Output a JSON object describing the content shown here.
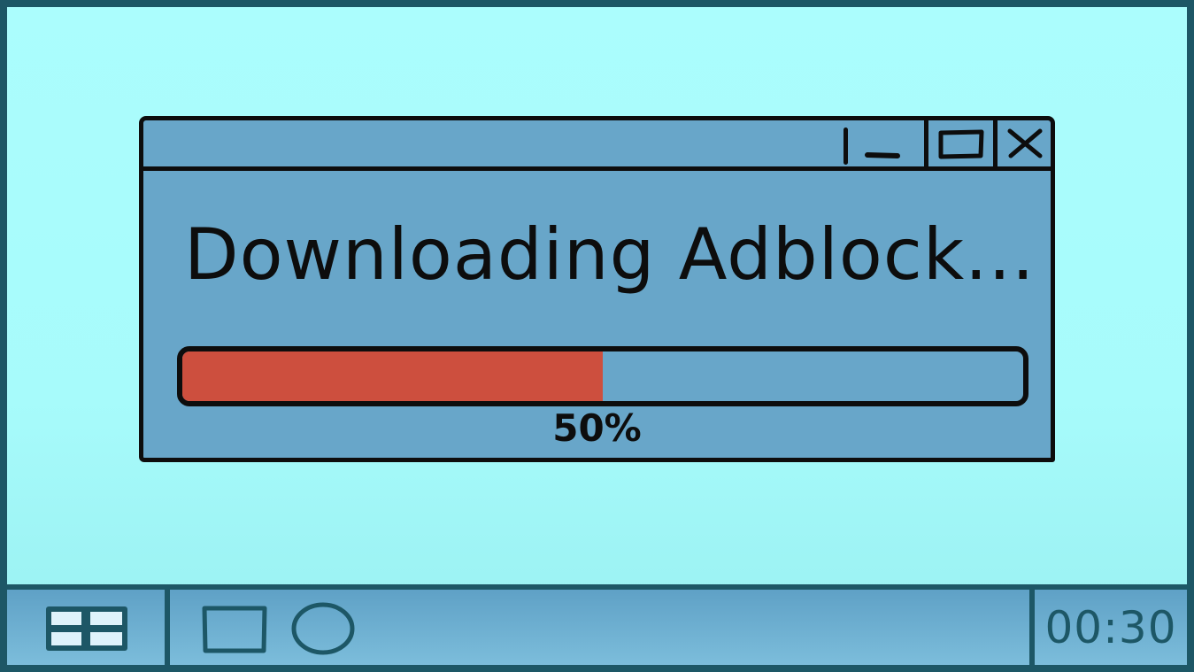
{
  "dialog": {
    "title": "Downloading Adblock...",
    "progress": {
      "fraction": 0.5,
      "label": "50%",
      "fill_color": "#cd4f3e",
      "track_color": "#68a6c9"
    },
    "controls": {
      "minimize_icon": "minimize-icon",
      "maximize_icon": "maximize-icon",
      "close_icon": "close-icon"
    }
  },
  "taskbar": {
    "start_icon": "start-grid-icon",
    "apps": [
      {
        "icon": "square-icon"
      },
      {
        "icon": "circle-icon"
      }
    ],
    "clock": "00:30"
  },
  "colors": {
    "desktop": "#abfdfd",
    "window": "#68a6c9",
    "frame": "#1d5766",
    "outline": "#0d0d0d"
  }
}
